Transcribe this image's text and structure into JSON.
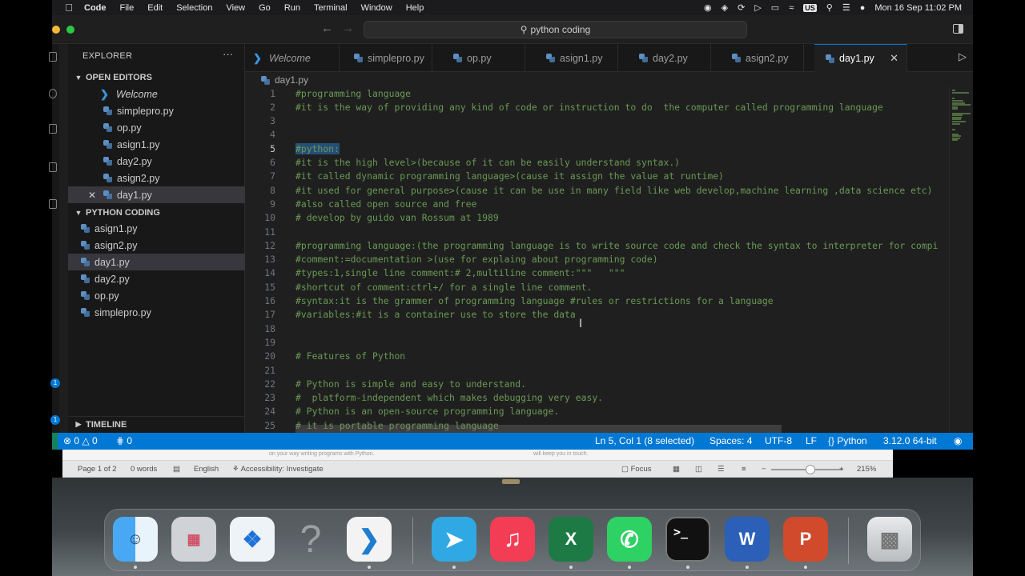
{
  "menubar": {
    "items": [
      "Code",
      "File",
      "Edit",
      "Selection",
      "View",
      "Go",
      "Run",
      "Terminal",
      "Window",
      "Help"
    ],
    "input_source": "US",
    "clock": "Mon 16 Sep  11:02 PM"
  },
  "titlebar": {
    "search": "python coding"
  },
  "sidebar": {
    "header": "EXPLORER",
    "open_editors_title": "OPEN EDITORS",
    "open_editors": [
      {
        "label": "Welcome"
      },
      {
        "label": "simplepro.py"
      },
      {
        "label": "op.py"
      },
      {
        "label": "asign1.py"
      },
      {
        "label": "day2.py"
      },
      {
        "label": "asign2.py"
      },
      {
        "label": "day1.py"
      }
    ],
    "folder_title": "PYTHON CODING",
    "files": [
      {
        "label": "asign1.py"
      },
      {
        "label": "asign2.py"
      },
      {
        "label": "day1.py"
      },
      {
        "label": "day2.py"
      },
      {
        "label": "op.py"
      },
      {
        "label": "simplepro.py"
      }
    ],
    "timeline_title": "TIMELINE",
    "badge_count": "1"
  },
  "tabs": [
    {
      "label": "Welcome"
    },
    {
      "label": "simplepro.py"
    },
    {
      "label": "op.py"
    },
    {
      "label": "asign1.py"
    },
    {
      "label": "day2.py"
    },
    {
      "label": "asign2.py"
    },
    {
      "label": "day1.py"
    }
  ],
  "breadcrumb": "day1.py",
  "code_lines": [
    {
      "n": "1",
      "text": "#programming language"
    },
    {
      "n": "2",
      "text": "#it is the way of providing any kind of code or instruction to do  the computer called programming language"
    },
    {
      "n": "3",
      "text": ""
    },
    {
      "n": "4",
      "text": ""
    },
    {
      "n": "5",
      "text": "#python:"
    },
    {
      "n": "6",
      "text": "#it is the high level>(because of it can be easily understand syntax.)"
    },
    {
      "n": "7",
      "text": "#it called dynamic programming language>(cause it assign the value at runtime)"
    },
    {
      "n": "8",
      "text": "#it used for general purpose>(cause it can be use in many field like web develop,machine learning ,data science etc)"
    },
    {
      "n": "9",
      "text": "#also called open source and free"
    },
    {
      "n": "10",
      "text": "# develop by guido van Rossum at 1989"
    },
    {
      "n": "11",
      "text": ""
    },
    {
      "n": "12",
      "text": "#programming language:(the programming language is to write source code and check the syntax to interpreter for compi"
    },
    {
      "n": "13",
      "text": "#comment:=documentation >(use for explaing about programming code)"
    },
    {
      "n": "14",
      "text": "#types:1,single line comment:# 2,multiline comment:\"\"\"   \"\"\""
    },
    {
      "n": "15",
      "text": "#shortcut of comment:ctrl+/ for a single line comment."
    },
    {
      "n": "16",
      "text": "#syntax:it is the grammer of programming language #rules or restrictions for a language"
    },
    {
      "n": "17",
      "text": "#variables:#it is a container use to store the data"
    },
    {
      "n": "18",
      "text": ""
    },
    {
      "n": "19",
      "text": ""
    },
    {
      "n": "20",
      "text": "# Features of Python"
    },
    {
      "n": "21",
      "text": ""
    },
    {
      "n": "22",
      "text": "# Python is simple and easy to understand."
    },
    {
      "n": "23",
      "text": "#  platform-independent which makes debugging very easy."
    },
    {
      "n": "24",
      "text": "# Python is an open-source programming language."
    },
    {
      "n": "25",
      "text": "# it is portable programming language"
    }
  ],
  "statusbar": {
    "errors": "0",
    "warnings": "0",
    "ports": "0",
    "cursor": "Ln 5, Col 1 (8 selected)",
    "spaces": "Spaces: 4",
    "encoding": "UTF-8",
    "eol": "LF",
    "language": "Python",
    "interpreter": "3.12.0 64-bit"
  },
  "word": {
    "page": "Page 1 of 2",
    "words": "0 words",
    "language": "English",
    "accessibility": "Accessibility: Investigate",
    "focus": "Focus",
    "zoom": "215%",
    "ruler_left": "on your way writing programs with Python.",
    "ruler_right": "will keep you in touch."
  },
  "dock": {
    "apps": [
      "finder",
      "launchpad",
      "safari",
      "help",
      "visual-studio-code",
      "telegram",
      "music",
      "excel",
      "whatsapp",
      "terminal",
      "word",
      "powerpoint",
      "trash"
    ],
    "terminal_prompt": ">_",
    "excel_letter": "X",
    "word_letter": "W",
    "powerpoint_letter": "P",
    "help_glyph": "?"
  },
  "colors": {
    "accent": "#0078d4",
    "comment": "#6a9955",
    "editor_bg": "#1f1f1f",
    "selection": "#264f78"
  }
}
